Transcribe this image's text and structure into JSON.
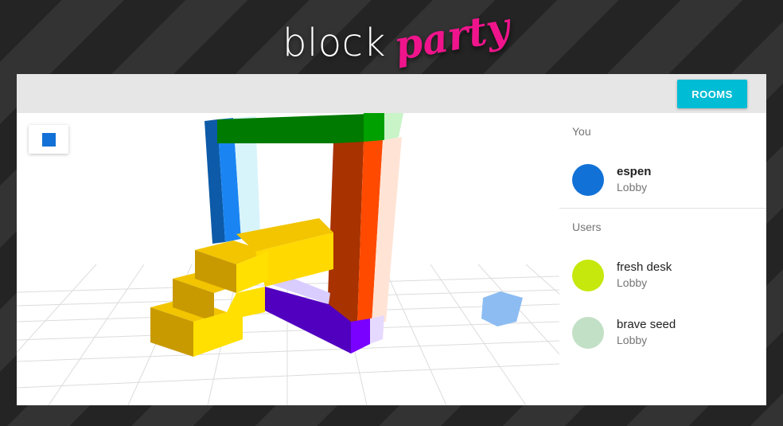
{
  "logo": {
    "word1": "block",
    "word2": "party"
  },
  "toolbar": {
    "rooms_label": "ROOMS"
  },
  "viewport": {
    "current_color": "#1271d6"
  },
  "sidebar": {
    "you_title": "You",
    "you": {
      "name": "espen",
      "room": "Lobby",
      "color": "#1271d6"
    },
    "users_title": "Users",
    "users": [
      {
        "name": "fresh desk",
        "room": "Lobby",
        "color": "#c6e80c"
      },
      {
        "name": "brave seed",
        "room": "Lobby",
        "color": "#c2e0c6"
      }
    ]
  },
  "colors": {
    "accent": "#00bcd4",
    "brand": "#f0148c"
  }
}
